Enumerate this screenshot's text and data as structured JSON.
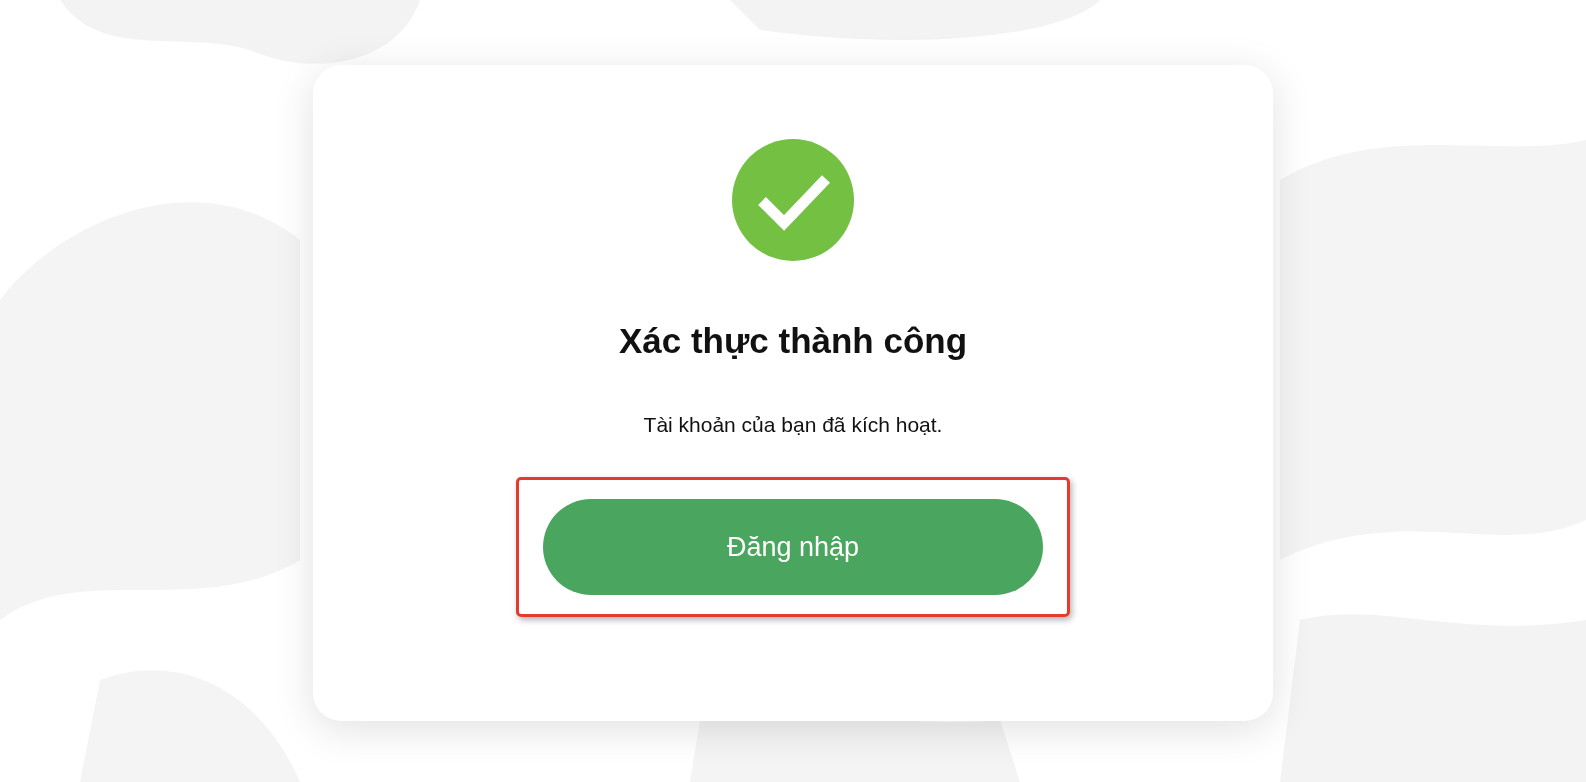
{
  "dialog": {
    "kind": "success",
    "title": "Xác thực thành công",
    "message": "Tài khoản của bạn đã kích hoạt.",
    "button": {
      "label": "Đăng nhập",
      "highlighted": true
    }
  }
}
